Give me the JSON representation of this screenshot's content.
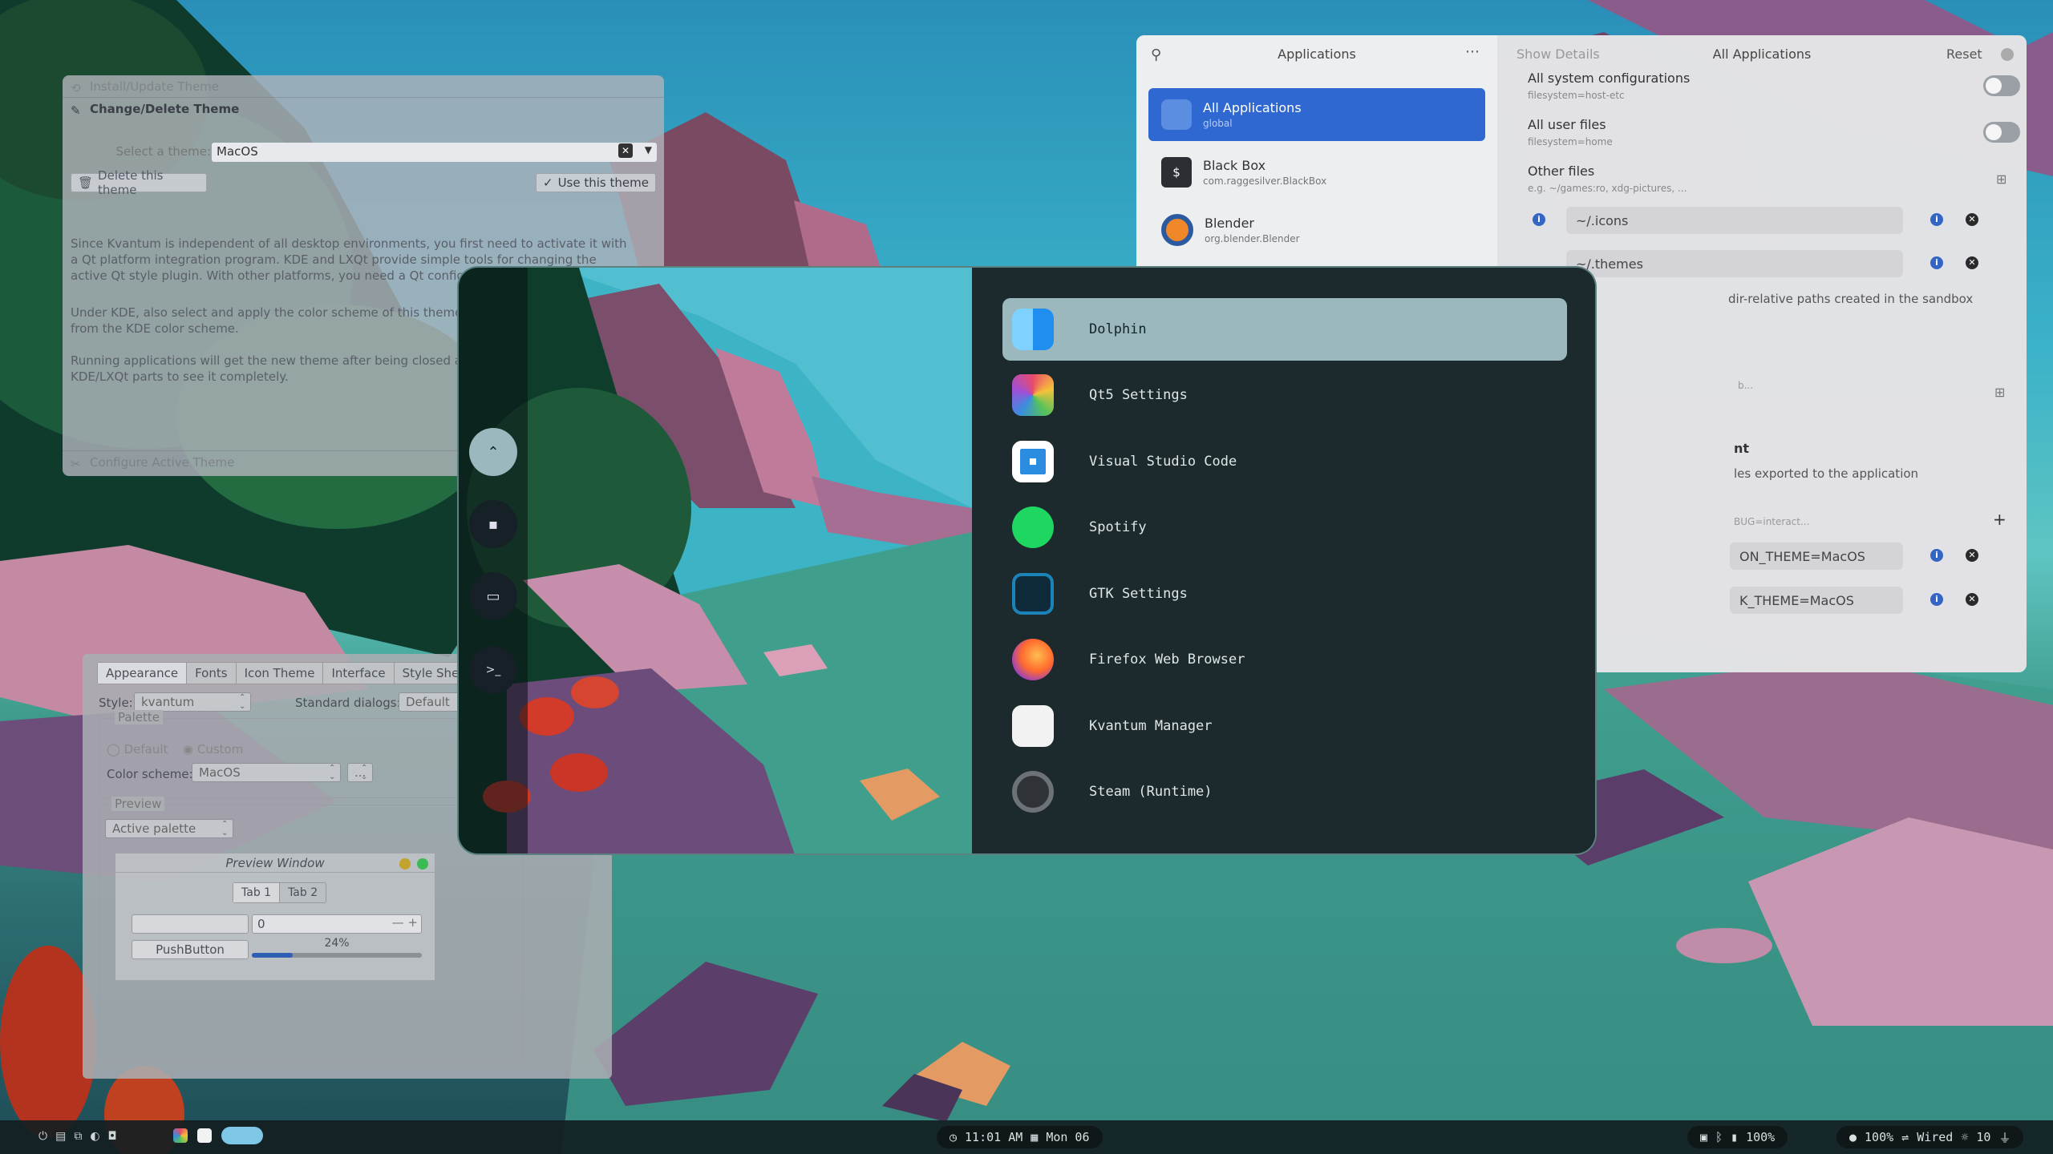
{
  "kvantum": {
    "install_tab": "Install/Update Theme",
    "change_tab": "Change/Delete Theme",
    "select_label": "Select a theme:",
    "select_value": "MacOS",
    "delete_button": "Delete this theme",
    "use_button": "Use this theme",
    "para1": "Since Kvantum is independent of all desktop environments, you first need to activate it with a Qt platform integration program. KDE and LXQt provide simple tools for changing the active Qt style plugin. With other platforms, you need a Qt configuration tool.",
    "para2": "Under KDE, also select and apply the color scheme of this theme be get their colors directly from the KDE color scheme.",
    "para3": "Running applications will get the new theme after being closed and would be good for all KDE/LXQt parts to see it completely.",
    "configure_tab": "Configure Active Theme"
  },
  "flatseal": {
    "header_title": "Applications",
    "show_details": "Show Details",
    "all_apps_title": "All Applications",
    "reset": "Reset",
    "apps": [
      {
        "name": "All Applications",
        "id": "global"
      },
      {
        "name": "Black Box",
        "id": "com.raggesilver.BlackBox"
      },
      {
        "name": "Blender",
        "id": "org.blender.Blender"
      }
    ],
    "sys_config": "All system configurations",
    "sys_config_sub": "filesystem=host-etc",
    "user_files": "All user files",
    "user_files_sub": "filesystem=home",
    "other_files": "Other files",
    "other_files_sub": "e.g. ~/games:ro, xdg-pictures, ...",
    "path_icons": "~/.icons",
    "path_themes": "~/.themes",
    "sandbox_text": "dir-relative paths created in the sandbox",
    "env_title": "nt",
    "env_sub": "les exported to the application",
    "env_placeholder": "BUG=interact...",
    "env_1": "ON_THEME=MacOS",
    "env_2": "K_THEME=MacOS",
    "sandbox_placeholder": "b..."
  },
  "qt5": {
    "tabs": [
      "Appearance",
      "Fonts",
      "Icon Theme",
      "Interface",
      "Style She"
    ],
    "style_label": "Style:",
    "style_value": "kvantum",
    "dialogs_label": "Standard dialogs:",
    "dialogs_value": "Default",
    "palette_label": "Palette",
    "default_radio": "Default",
    "custom_radio": "Custom",
    "scheme_label": "Color scheme:",
    "scheme_value": "MacOS",
    "scheme_more": "...",
    "preview_label": "Preview",
    "palette_combo": "Active palette",
    "preview_title": "Preview Window",
    "tab1": "Tab 1",
    "tab2": "Tab 2",
    "spin_value": "0",
    "push_button": "PushButton",
    "progress_text": "24%",
    "progress_value": 0.24
  },
  "launcher": {
    "items": [
      "Dolphin",
      "Qt5 Settings",
      "Visual Studio Code",
      "Spotify",
      "GTK Settings",
      "Firefox Web Browser",
      "Kvantum Manager",
      "Steam (Runtime)"
    ],
    "selected": 0,
    "rail_icons": [
      "chevron-up-icon",
      "folder-icon",
      "window-icon",
      "terminal-icon"
    ]
  },
  "taskbar": {
    "clock": "11:01 AM",
    "date": "Mon 06",
    "battery_right": "100%",
    "volume": "100%",
    "network": "Wired",
    "brightness": "10"
  }
}
